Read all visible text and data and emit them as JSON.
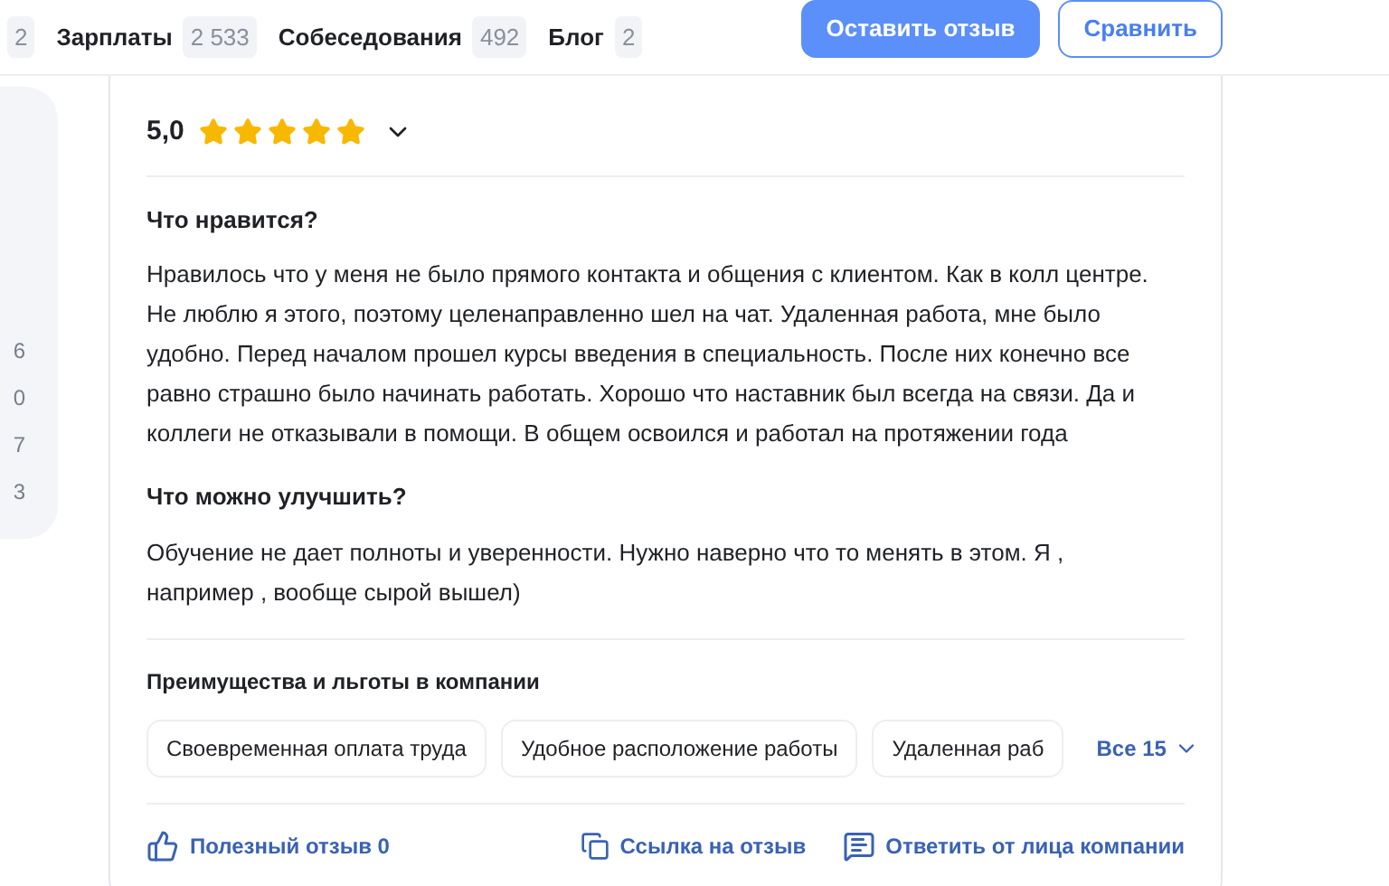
{
  "nav": {
    "items": [
      {
        "count": "2"
      },
      {
        "label": "Зарплаты",
        "count": "2 533"
      },
      {
        "label": "Собеседования",
        "count": "492"
      },
      {
        "label": "Блог",
        "count": "2"
      }
    ],
    "primary_button": "Оставить отзыв",
    "secondary_button": "Сравнить"
  },
  "sidebar": {
    "counts": [
      "6",
      "0",
      "7",
      "3"
    ]
  },
  "review": {
    "rating": "5,0",
    "stars": 5,
    "sections": [
      {
        "title": "Что нравится?",
        "text": "Нравилось что у меня не было прямого контакта и общения с клиентом. Как в колл центре. Не люблю я этого, поэтому целенаправленно шел на чат. Удаленная работа, мне было удобно. Перед началом прошел курсы введения в специальность. После них конечно все равно страшно было начинать работать. Хорошо что наставник был всегда на связи. Да и коллеги не отказывали в помощи. В общем освоился и работал на протяжении года"
      },
      {
        "title": "Что можно улучшить?",
        "text": "Обучение не дает полноты и уверенности. Нужно наверно что то менять в этом. Я , например , вообще сырой вышел)"
      }
    ],
    "benefits": {
      "title": "Преимущества и льготы в компании",
      "tags": [
        "Своевременная оплата труда",
        "Удобное расположение работы",
        "Удаленная раб"
      ],
      "more": "Все 15"
    },
    "actions": {
      "helpful": "Полезный отзыв 0",
      "link": "Ссылка на отзыв",
      "reply": "Ответить от лица компании"
    }
  }
}
